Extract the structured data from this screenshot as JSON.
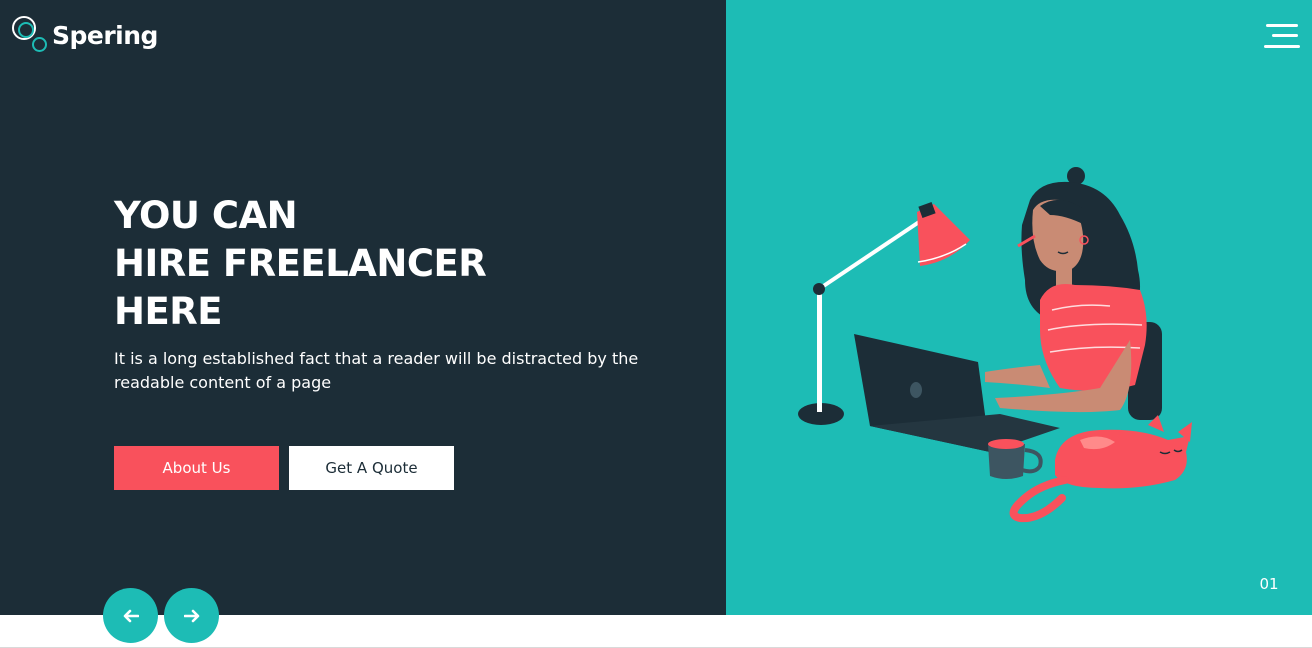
{
  "brand": {
    "name": "Spering"
  },
  "hero": {
    "title_lines": [
      "YOU CAN",
      "HIRE FREELANCER",
      "HERE"
    ],
    "description": "It is a long established fact that a reader will be distracted by the readable content of a page",
    "buttons": {
      "about_label": "About Us",
      "quote_label": "Get A Quote"
    }
  },
  "slider": {
    "current_slide": "01",
    "prev_icon": "arrow-left-icon",
    "next_icon": "arrow-right-icon"
  },
  "header": {
    "menu_icon": "hamburger-menu-icon"
  },
  "colors": {
    "dark_panel": "#1c2d37",
    "accent_teal": "#1dbcb5",
    "accent_coral": "#f9515c",
    "white": "#ffffff"
  }
}
